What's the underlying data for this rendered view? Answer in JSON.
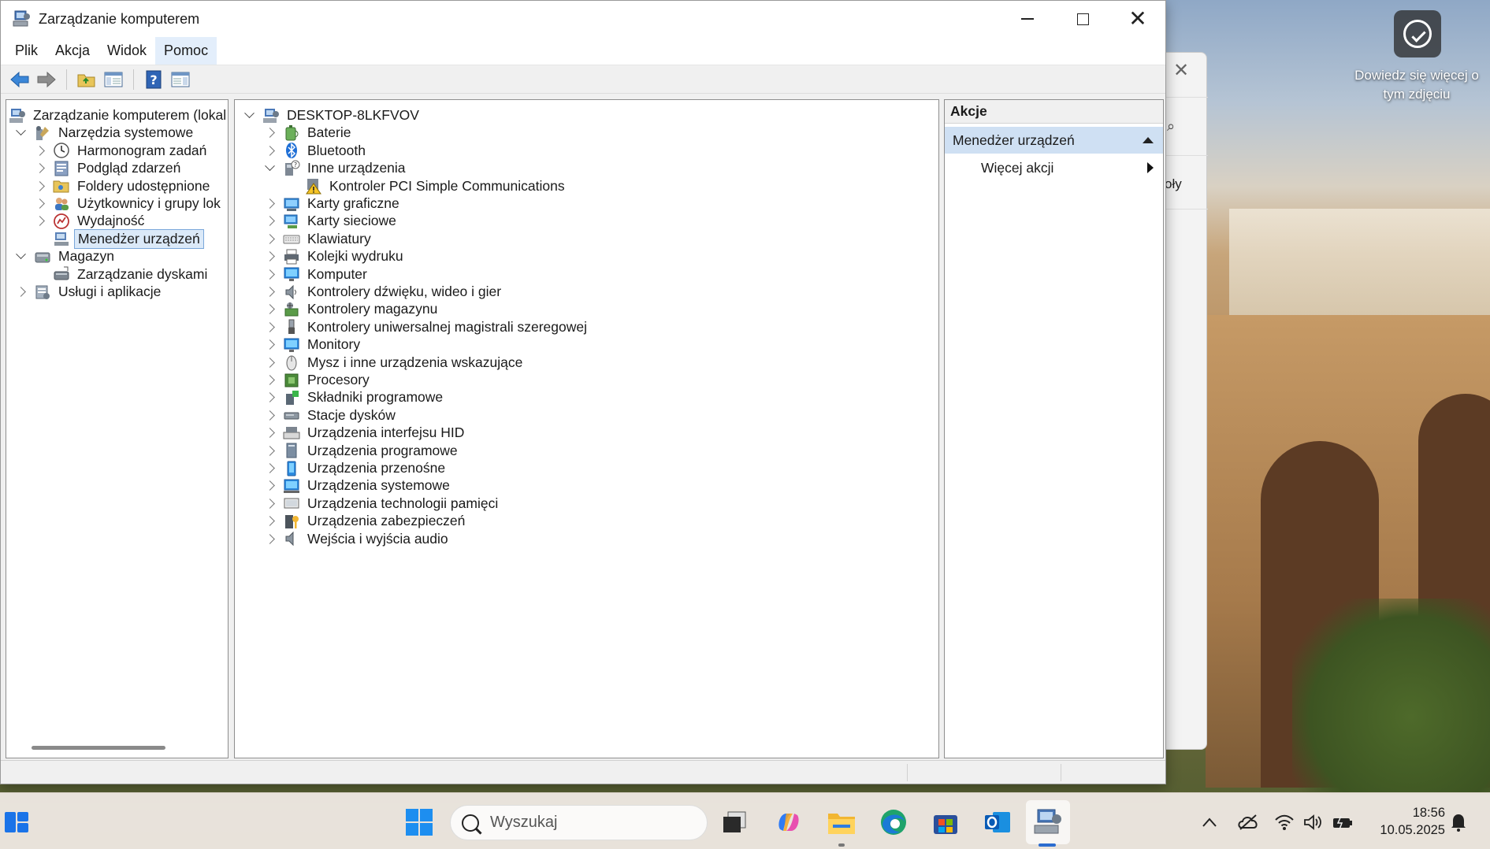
{
  "window": {
    "title": "Zarządzanie komputerem",
    "menu": [
      "Plik",
      "Akcja",
      "Widok",
      "Pomoc"
    ]
  },
  "left_tree": [
    {
      "label": "Zarządzanie komputerem (lokal",
      "icon": "computer-management-icon",
      "level": 0,
      "chevron": "none"
    },
    {
      "label": "Narzędzia systemowe",
      "icon": "system-tools-icon",
      "level": 1,
      "chevron": "down"
    },
    {
      "label": "Harmonogram zadań",
      "icon": "clock-icon",
      "level": 2,
      "chevron": "right"
    },
    {
      "label": "Podgląd zdarzeń",
      "icon": "event-viewer-icon",
      "level": 2,
      "chevron": "right"
    },
    {
      "label": "Foldery udostępnione",
      "icon": "shared-folder-icon",
      "level": 2,
      "chevron": "right"
    },
    {
      "label": "Użytkownicy i grupy lok",
      "icon": "users-icon",
      "level": 2,
      "chevron": "right"
    },
    {
      "label": "Wydajność",
      "icon": "performance-icon",
      "level": 2,
      "chevron": "right"
    },
    {
      "label": "Menedżer urządzeń",
      "icon": "device-manager-icon",
      "level": 2,
      "chevron": "none",
      "selected": true
    },
    {
      "label": "Magazyn",
      "icon": "storage-icon",
      "level": 1,
      "chevron": "down"
    },
    {
      "label": "Zarządzanie dyskami",
      "icon": "disk-management-icon",
      "level": 2,
      "chevron": "none"
    },
    {
      "label": "Usługi i aplikacje",
      "icon": "services-icon",
      "level": 1,
      "chevron": "right"
    }
  ],
  "device_tree": {
    "root": "DESKTOP-8LKFVOV",
    "items": [
      {
        "label": "Baterie",
        "icon": "battery-icon",
        "chevron": "right"
      },
      {
        "label": "Bluetooth",
        "icon": "bluetooth-icon",
        "chevron": "right"
      },
      {
        "label": "Inne urządzenia",
        "icon": "unknown-device-icon",
        "chevron": "down"
      },
      {
        "label": "Kontroler PCI Simple Communications",
        "icon": "warning-device-icon",
        "chevron": "none",
        "child": true
      },
      {
        "label": "Karty graficzne",
        "icon": "display-adapter-icon",
        "chevron": "right"
      },
      {
        "label": "Karty sieciowe",
        "icon": "network-adapter-icon",
        "chevron": "right"
      },
      {
        "label": "Klawiatury",
        "icon": "keyboard-icon",
        "chevron": "right"
      },
      {
        "label": "Kolejki wydruku",
        "icon": "printer-icon",
        "chevron": "right"
      },
      {
        "label": "Komputer",
        "icon": "monitor-icon",
        "chevron": "right"
      },
      {
        "label": "Kontrolery dźwięku, wideo i gier",
        "icon": "speaker-icon",
        "chevron": "right"
      },
      {
        "label": "Kontrolery magazynu",
        "icon": "storage-controller-icon",
        "chevron": "right"
      },
      {
        "label": "Kontrolery uniwersalnej magistrali szeregowej",
        "icon": "usb-icon",
        "chevron": "right"
      },
      {
        "label": "Monitory",
        "icon": "monitor-icon",
        "chevron": "right"
      },
      {
        "label": "Mysz i inne urządzenia wskazujące",
        "icon": "mouse-icon",
        "chevron": "right"
      },
      {
        "label": "Procesory",
        "icon": "cpu-icon",
        "chevron": "right"
      },
      {
        "label": "Składniki programowe",
        "icon": "software-component-icon",
        "chevron": "right"
      },
      {
        "label": "Stacje dysków",
        "icon": "disk-drive-icon",
        "chevron": "right"
      },
      {
        "label": "Urządzenia interfejsu HID",
        "icon": "hid-icon",
        "chevron": "right"
      },
      {
        "label": "Urządzenia programowe",
        "icon": "software-device-icon",
        "chevron": "right"
      },
      {
        "label": "Urządzenia przenośne",
        "icon": "portable-device-icon",
        "chevron": "right"
      },
      {
        "label": "Urządzenia systemowe",
        "icon": "system-device-icon",
        "chevron": "right"
      },
      {
        "label": "Urządzenia technologii pamięci",
        "icon": "memory-tech-icon",
        "chevron": "right"
      },
      {
        "label": "Urządzenia zabezpieczeń",
        "icon": "security-device-icon",
        "chevron": "right"
      },
      {
        "label": "Wejścia i wyjścia audio",
        "icon": "audio-io-icon",
        "chevron": "right"
      }
    ]
  },
  "actions": {
    "header": "Akcje",
    "section": "Menedżer urządzeń",
    "more": "Więcej akcji"
  },
  "desktop": {
    "spotlight_text": "Dowiedz się więcej o tym zdjęciu",
    "bg_window_fragment": "oły"
  },
  "taskbar": {
    "search_placeholder": "Wyszukaj",
    "time": "18:56",
    "date": "10.05.2025",
    "apps": [
      "start-icon",
      "task-view-icon",
      "copilot-icon",
      "file-explorer-icon",
      "edge-icon",
      "store-icon",
      "outlook-icon",
      "computer-management-icon"
    ],
    "tray": [
      "chevron-up-icon",
      "onedrive-icon",
      "wifi-icon",
      "volume-icon",
      "battery-icon",
      "notification-icon"
    ]
  },
  "colors": {
    "selection": "#cfe0f3",
    "menu_hover": "#e3eefb",
    "accent": "#2b6ccf"
  }
}
